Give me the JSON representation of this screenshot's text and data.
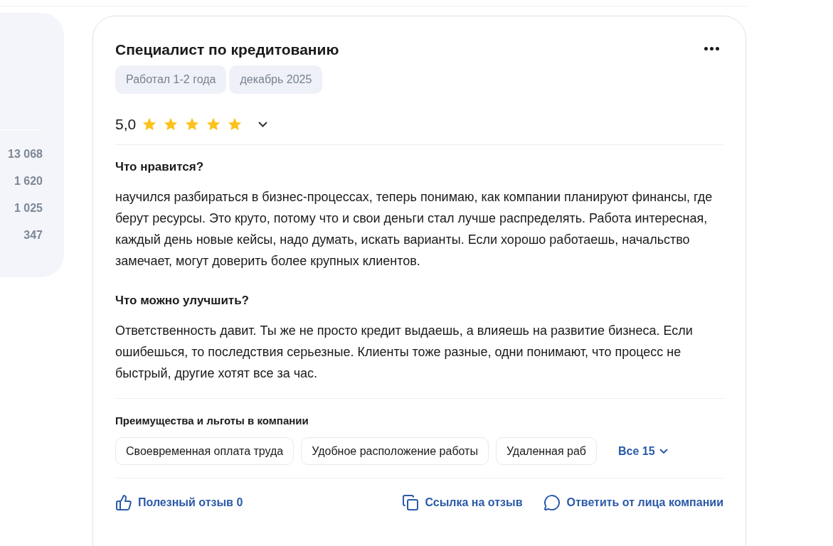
{
  "side_counts": [
    "13 068",
    "1 620",
    "1 025",
    "347"
  ],
  "review": {
    "position": "Специалист по кредитованию",
    "tags": [
      "Работал 1-2 года",
      "декабрь 2025"
    ],
    "rating": "5,0",
    "stars": 5,
    "sections": [
      {
        "heading": "Что нравится?",
        "text": "научился разбираться в бизнес-процессах, теперь понимаю, как компании планируют финансы, где берут ресурсы. Это круто, потому что и свои деньги стал лучше распределять. Работа интересная, каждый день новые кейсы, надо думать, искать варианты. Если хорошо работаешь, начальство замечает, могут доверить более крупных клиентов."
      },
      {
        "heading": "Что можно улучшить?",
        "text": "Ответственность давит. Ты же не просто кредит выдаешь, а влияешь на развитие бизнеса. Если ошибешься, то последствия серьезные. Клиенты тоже разные, одни понимают, что процесс не быстрый, другие хотят все за час."
      }
    ],
    "benefits": {
      "heading": "Преимущества и льготы в компании",
      "items": [
        "Своевременная оплата труда",
        "Удобное расположение работы",
        "Удаленная раб"
      ],
      "more": "Все 15"
    },
    "actions": [
      {
        "kind": "like",
        "label": "Полезный отзыв 0"
      },
      {
        "kind": "link",
        "label": "Ссылка на отзыв"
      },
      {
        "kind": "reply",
        "label": "Ответить от лица компании"
      }
    ]
  }
}
